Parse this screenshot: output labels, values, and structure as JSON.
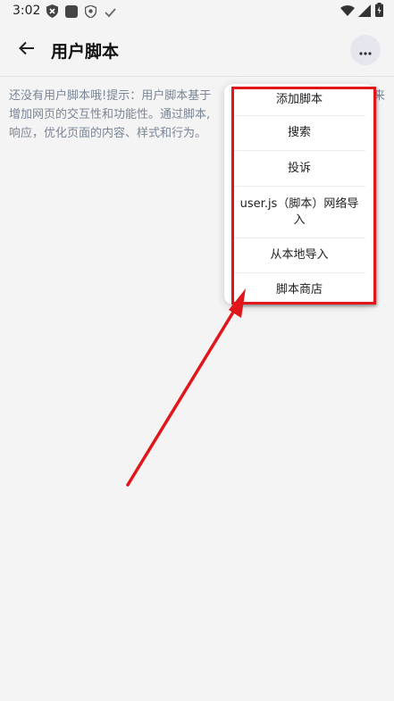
{
  "status_bar": {
    "time": "3:02",
    "left_icons": [
      "shield-x-icon",
      "square-app-icon",
      "vpn-shield-icon",
      "check-icon"
    ],
    "right_icons": [
      "wifi-icon",
      "signal-icon",
      "battery-charging-icon"
    ]
  },
  "app_bar": {
    "back_icon": "arrow-left-icon",
    "title": "用户脚本",
    "more_icon": "more-dots-icon"
  },
  "content": {
    "hint_line1": "还没有用户脚本哦!提示：用户脚本基于",
    "hint_line1_tail": "来",
    "hint_line2": "增加网页的交互性和功能性。通过脚本,",
    "hint_line3": "响应，优化页面的内容、样式和行为。"
  },
  "menu": {
    "items": [
      {
        "label": "添加脚本"
      },
      {
        "label": "搜索"
      },
      {
        "label": "投诉"
      },
      {
        "label": "user.js（脚本）网络导入"
      },
      {
        "label": "从本地导入"
      },
      {
        "label": "脚本商店"
      }
    ]
  },
  "annotation": {
    "color": "#e0161b"
  }
}
